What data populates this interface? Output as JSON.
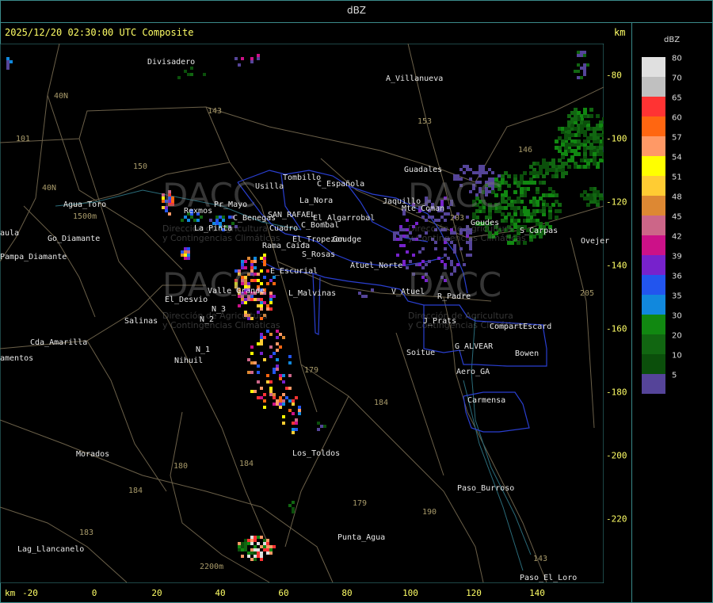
{
  "window": {
    "title": "dBZ"
  },
  "header": {
    "timestamp": "2025/12/20 02:30:00 UTC Composite",
    "unit_top": "km",
    "unit_bottom": "km"
  },
  "axes": {
    "x_ticks": [
      "-20",
      "0",
      "20",
      "40",
      "60",
      "80",
      "100",
      "120",
      "140"
    ],
    "y_ticks": [
      "-80",
      "-100",
      "-120",
      "-140",
      "-160",
      "-180",
      "-200",
      "-220"
    ]
  },
  "legend": {
    "title": "dBZ",
    "items": [
      {
        "label": "80",
        "color": "#e0e0e0"
      },
      {
        "label": "70",
        "color": "#c0c0c0"
      },
      {
        "label": "65",
        "color": "#ff3333"
      },
      {
        "label": "60",
        "color": "#ff6611"
      },
      {
        "label": "57",
        "color": "#ff9966"
      },
      {
        "label": "54",
        "color": "#ffff00"
      },
      {
        "label": "51",
        "color": "#ffcc33"
      },
      {
        "label": "48",
        "color": "#dd8833"
      },
      {
        "label": "45",
        "color": "#cc6688"
      },
      {
        "label": "42",
        "color": "#cc1188"
      },
      {
        "label": "39",
        "color": "#7722cc"
      },
      {
        "label": "36",
        "color": "#2255ee"
      },
      {
        "label": "35",
        "color": "#1188dd"
      },
      {
        "label": "30",
        "color": "#118811"
      },
      {
        "label": "20",
        "color": "#116611"
      },
      {
        "label": "10",
        "color": "#0b4f0b"
      },
      {
        "label": "5",
        "color": "#554499"
      }
    ]
  },
  "places": [
    {
      "name": "Divisadero"
    },
    {
      "name": "A_Villanueva"
    },
    {
      "name": "Guadales"
    },
    {
      "name": "Tombillo"
    },
    {
      "name": "C_Española"
    },
    {
      "name": "Usilla"
    },
    {
      "name": "La_Nora"
    },
    {
      "name": "Agua_Toro"
    },
    {
      "name": "Rexmos"
    },
    {
      "name": "Pr_Mayo"
    },
    {
      "name": "C_Benegas"
    },
    {
      "name": "SAN_RAFAEL"
    },
    {
      "name": "El_Algarrobal"
    },
    {
      "name": "C_Bombal"
    },
    {
      "name": "Cuadro"
    },
    {
      "name": "Rama_Caida"
    },
    {
      "name": "El_Tropezon"
    },
    {
      "name": "Goudge"
    },
    {
      "name": "S_Rosas"
    },
    {
      "name": "Atuel_Norte"
    },
    {
      "name": "E_Escurial"
    },
    {
      "name": "Valle_Grande"
    },
    {
      "name": "L_Malvinas"
    },
    {
      "name": "El_Desvio"
    },
    {
      "name": "Salinas"
    },
    {
      "name": "V_Atuel"
    },
    {
      "name": "R_Padre"
    },
    {
      "name": "J_Prats"
    },
    {
      "name": "CompartEscard"
    },
    {
      "name": "G_ALVEAR"
    },
    {
      "name": "Bowen"
    },
    {
      "name": "Soitue"
    },
    {
      "name": "Aero_GA"
    },
    {
      "name": "Carmensa"
    },
    {
      "name": "Cda_Amarilla"
    },
    {
      "name": "amentos"
    },
    {
      "name": "Pampa_Diamante"
    },
    {
      "name": "aula"
    },
    {
      "name": "Nihuil"
    },
    {
      "name": "N_1"
    },
    {
      "name": "N_2"
    },
    {
      "name": "N_3"
    },
    {
      "name": "Morados"
    },
    {
      "name": "Los_Toldos"
    },
    {
      "name": "Paso_Burroso"
    },
    {
      "name": "Punta_Agua"
    },
    {
      "name": "Lag_Llancanelo"
    },
    {
      "name": "Paso_El_Loro"
    },
    {
      "name": "Goudes"
    },
    {
      "name": "S_Carpas"
    },
    {
      "name": "Ovejer"
    },
    {
      "name": "Mte_Coman"
    },
    {
      "name": "Jaquillo"
    },
    {
      "name": "La_Pinta"
    },
    {
      "name": "Go_Diamante"
    },
    {
      "name": "40N"
    }
  ],
  "roads": [
    "143",
    "153",
    "146",
    "101",
    "150",
    "203",
    "40N",
    "40N",
    "205",
    "179",
    "184",
    "180",
    "184",
    "183",
    "184",
    "179",
    "190",
    "143",
    "1500m",
    "2200m"
  ],
  "watermark": {
    "logo_text": "DACC",
    "sub_line1": "Dirección de Agricultura",
    "sub_line2": "y Contingencias Climáticas"
  },
  "colors": {
    "border": "#3a8a8a",
    "text_header": "#ffff66",
    "boundary_blue": "#2a3fd0",
    "road": "#6b6049"
  }
}
